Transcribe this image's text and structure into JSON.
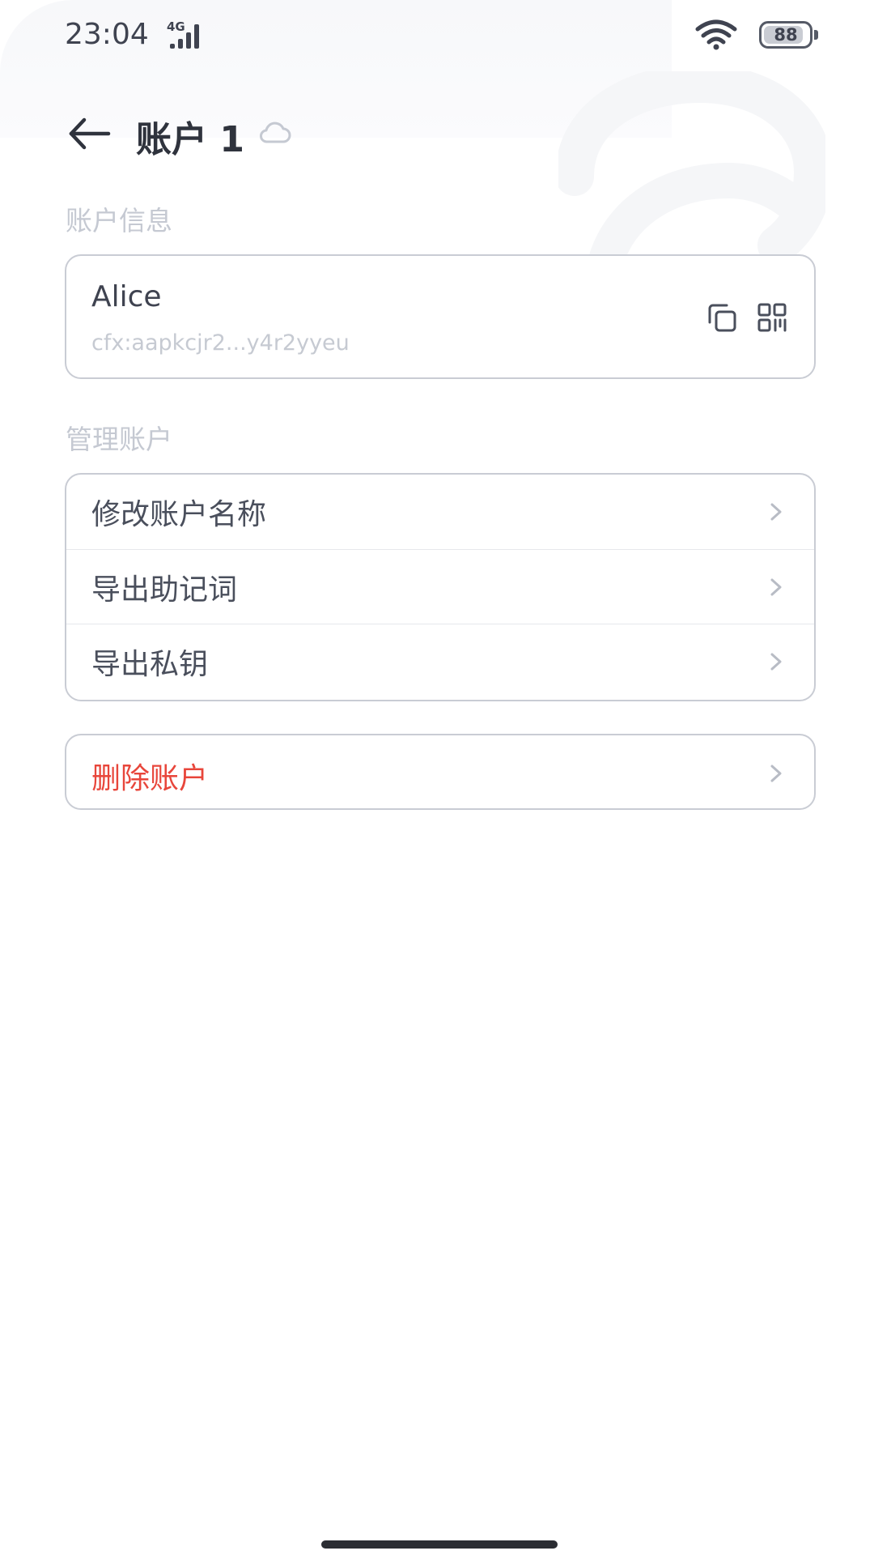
{
  "status_bar": {
    "time": "23:04",
    "network_type": "4G",
    "battery_level": "88",
    "battery_fraction": 0.88
  },
  "header": {
    "title": "账户 1",
    "back_icon": "arrow-left-icon",
    "cloud_icon": "cloud-icon"
  },
  "account_info": {
    "section_label": "账户信息",
    "name": "Alice",
    "address": "cfx:aapkcjr2...y4r2yyeu",
    "copy_icon": "copy-icon",
    "qr_icon": "qr-code-icon"
  },
  "manage": {
    "section_label": "管理账户",
    "items": [
      {
        "label": "修改账户名称"
      },
      {
        "label": "导出助记词"
      },
      {
        "label": "导出私钥"
      }
    ]
  },
  "danger": {
    "delete_label": "删除账户",
    "color": "#e8463b"
  },
  "colors": {
    "text_primary": "#3f4350",
    "text_muted": "#c5c9d2",
    "border": "#c9ccd4"
  }
}
